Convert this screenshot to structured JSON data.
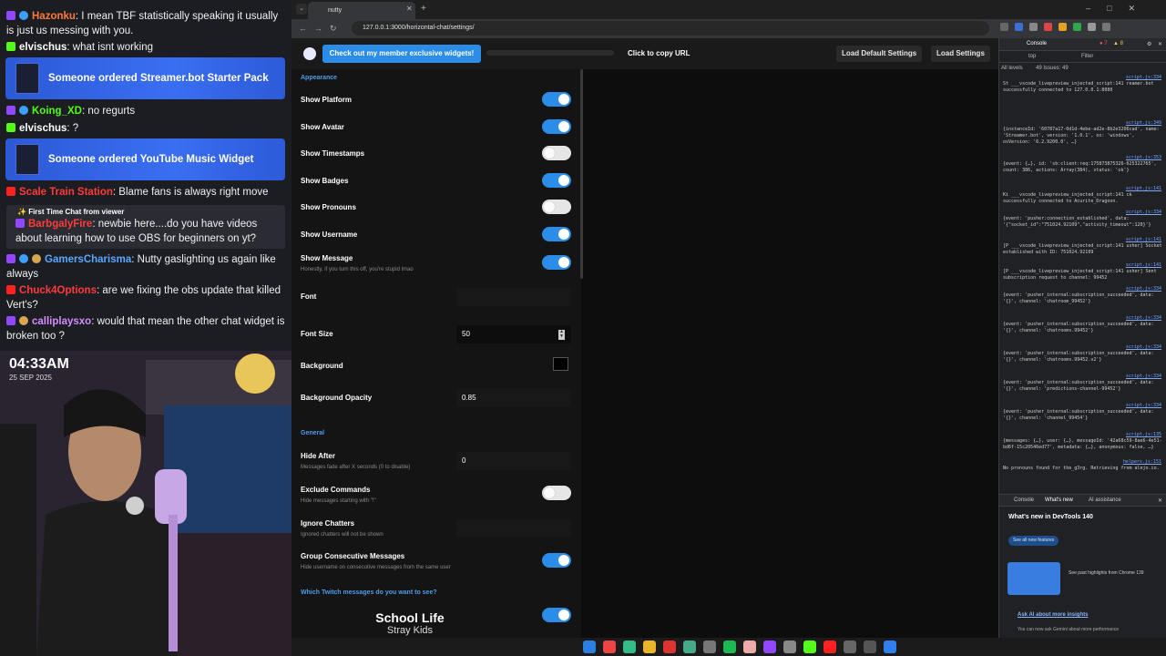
{
  "chat": {
    "lines": [
      {
        "icon": "twitch",
        "user": "Hazonku",
        "color": "#ff7b3c",
        "text": ": I mean TBF statistically speaking it usually is just us messing with you."
      },
      {
        "icon": "kick",
        "user": "elvischus",
        "color": "#ffffff",
        "text": ": what isnt working"
      },
      {
        "icon": "twitch",
        "user": "Koing_XD",
        "color": "#53fc18",
        "text": ": no regurts"
      },
      {
        "icon": "kick",
        "user": "elvischus",
        "color": "#ffffff",
        "text": ": ?"
      },
      {
        "icon": "yt",
        "user": "Scale Train Station",
        "color": "#ff3b3b",
        "text": ": Blame fans is always right move"
      },
      {
        "icon": "twitch",
        "user": "GamersCharisma",
        "color": "#5aa8ff",
        "text": ": Nutty gaslighting us again like always"
      },
      {
        "icon": "yt",
        "user": "Chuck4Options",
        "color": "#ff3b3b",
        "text": ": are we fixing the obs update that killed Vert's?"
      },
      {
        "icon": "twitch",
        "user": "calliplaysxo",
        "color": "#d48cff",
        "text": ": would that mean the other chat widget is broken too ?"
      }
    ],
    "orders": [
      "Someone ordered Streamer.bot Starter Pack",
      "Someone ordered YouTube Music Widget"
    ],
    "first_time": {
      "header": "First Time Chat from viewer",
      "user": "BarbgalyFire",
      "text": ": newbie here....do you have videos about learning how to use OBS for beginners on yt?"
    }
  },
  "cam": {
    "time": "04:33AM",
    "date": "25 SEP 2025"
  },
  "browser": {
    "tab_title": "nutty",
    "url": "127.0.0.1:3000/horizontal-chat/settings/"
  },
  "page": {
    "promo": "Check out my member exclusive widgets!",
    "copy_url": "Click to copy URL",
    "load_default": "Load Default Settings",
    "load_settings": "Load Settings",
    "sections": {
      "appearance": "Appearance",
      "general": "General",
      "twitch": "Which Twitch messages do you want to see?"
    },
    "settings": {
      "show_platform": "Show Platform",
      "show_avatar": "Show Avatar",
      "show_timestamps": "Show Timestamps",
      "show_badges": "Show Badges",
      "show_pronouns": "Show Pronouns",
      "show_username": "Show Username",
      "show_message": "Show Message",
      "show_message_sub": "Honestly, if you turn this off, you're stupid lmao",
      "font": "Font",
      "font_size": "Font Size",
      "font_size_value": "50",
      "background": "Background",
      "background_opacity": "Background Opacity",
      "background_opacity_value": "0.85",
      "hide_after": "Hide After",
      "hide_after_sub": "Messages fade after X seconds (0 to disable)",
      "hide_after_value": "0",
      "exclude_commands": "Exclude Commands",
      "exclude_commands_sub": "Hide messages starting with \"!\"",
      "ignore_chatters": "Ignore Chatters",
      "ignore_chatters_sub": "Ignored chatters will not be shown",
      "group_consecutive": "Group Consecutive Messages",
      "group_consecutive_sub": "Hide username on consecutive messages from the same user"
    },
    "toggles": {
      "show_platform": true,
      "show_avatar": true,
      "show_timestamps": false,
      "show_badges": true,
      "show_pronouns": false,
      "show_username": true,
      "show_message": true,
      "exclude_commands": false,
      "group_consecutive": true,
      "twitch_chat": true
    },
    "background_color": "#000000",
    "accent": "#2b8de8"
  },
  "devtools": {
    "tabs": [
      "Console"
    ],
    "errors": "7",
    "warnings": "8",
    "context": "top",
    "filter": "Filter",
    "levels": "All levels",
    "issues": "49 Issues: 49",
    "drawer_tabs": [
      "Console",
      "What's new",
      "AI assistance"
    ],
    "whats_new_title": "What's new in DevTools 140",
    "see_all": "See all new features",
    "highlights": "See past highlights from Chrome 139",
    "ask_ai": "Ask AI about more insights",
    "ask_ai_sub": "You can now ask Gemini about more performance",
    "logs": [
      {
        "src": "script.js:334",
        "text": "St ___vscode_livepreview_injected_script:141 reamer.bot successfully connected to 127.0.0.1:8080"
      },
      {
        "src": "script.js:349",
        "text": "{instanceId: '60787a17-0d1d-4ebe-ad2e-8b2e3206cad', name: 'Streamer.bot', version: '1.0.1', os: 'windows', osVersion: '6.2.9200.0', …}"
      },
      {
        "src": "script.js:353",
        "text": "{event: {…}, id: 'sb:client:req:175873875326-625322765', count: 386, actions: Array(384), status: 'ok'}"
      },
      {
        "src": "script.js:141",
        "text": "Ki ___vscode_livepreview_injected_script:141 ck successfully connected to Acurite_Dragoon."
      },
      {
        "src": "script.js:334",
        "text": "{event: 'pusher:connection_established', data: '{\"socket_id\":\"751024.92109\",\"activity_timeout\":120}'}"
      },
      {
        "src": "script.js:141",
        "text": "[P ___vscode_livepreview_injected_script:141 usher] Socket established with ID: 751024.92109"
      },
      {
        "src": "script.js:141",
        "text": "[P ___vscode_livepreview_injected_script:141 usher] Sent subscription request to channel: 99452"
      },
      {
        "src": "script.js:334",
        "text": "{event: 'pusher_internal:subscription_succeeded', data: '{}', channel: 'chatroom_99452'}"
      },
      {
        "src": "script.js:334",
        "text": "{event: 'pusher_internal:subscription_succeeded', data: '{}', channel: 'chatrooms.99452'}"
      },
      {
        "src": "script.js:334",
        "text": "{event: 'pusher_internal:subscription_succeeded', data: '{}', channel: 'chatrooms.99452.v2'}"
      },
      {
        "src": "script.js:334",
        "text": "{event: 'pusher_internal:subscription_succeeded', data: '{}', channel: 'predictions-channel-99452'}"
      },
      {
        "src": "script.js:334",
        "text": "{event: 'pusher_internal:subscription_succeeded', data: '{}', channel: 'channel_99454'}"
      },
      {
        "src": "script.js:135",
        "text": "{messages: {…}, user: {…}, messageId: '42a68c59-8ae6-4e51-bd6f-15c20546ed77', metadata: {…}, anonymous: false, …}"
      },
      {
        "src": "helpers.js:151",
        "text": "No pronouns found for the_g3rg. Retrieving from alejo.io."
      }
    ]
  },
  "song": {
    "title": "School Life",
    "artist": "Stray Kids"
  }
}
